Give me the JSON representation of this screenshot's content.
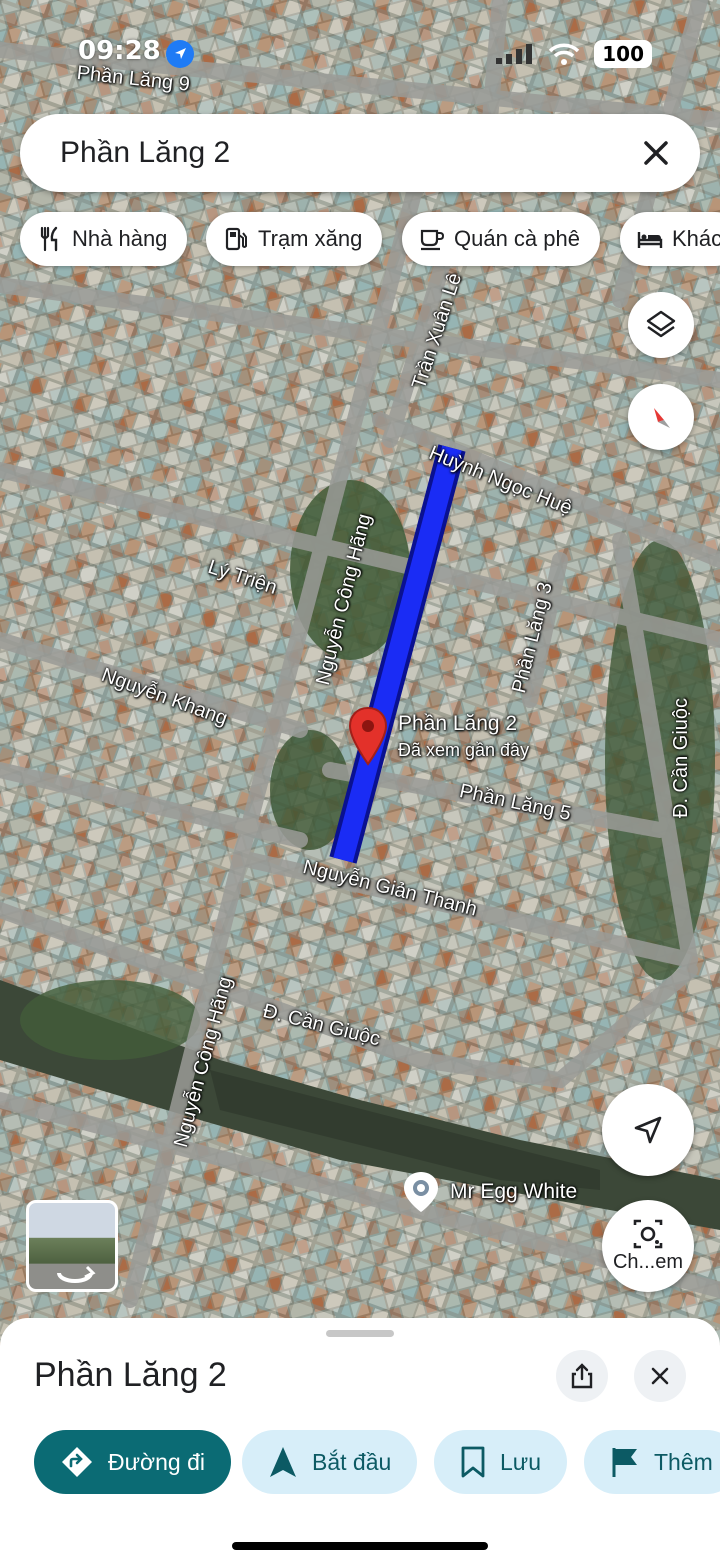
{
  "status_bar": {
    "time": "09:28",
    "battery": "100"
  },
  "search": {
    "query": "Phần Lăng 2"
  },
  "chips": [
    {
      "icon": "restaurant-icon",
      "label": "Nhà hàng"
    },
    {
      "icon": "gas-station-icon",
      "label": "Trạm xăng"
    },
    {
      "icon": "coffee-icon",
      "label": "Quán cà phê"
    },
    {
      "icon": "hotel-bed-icon",
      "label": "Khác"
    }
  ],
  "map": {
    "streets": [
      "Phần Lăng 9",
      "Trần Xuân Lê",
      "Huỳnh Ngọc Huệ",
      "Lý Triện",
      "Nguyễn Công Hãng",
      "Phần Lăng 3",
      "Nguyễn Khang",
      "Phần Lăng 5",
      "Nguyễn Giản Thanh",
      "Đ. Cần Giuộc",
      "Đ. Cần Giuộc",
      "Nguyễn Công Hãng"
    ],
    "pin": {
      "title": "Phần Lăng 2",
      "subtitle": "Đã xem gần đây"
    },
    "poi": {
      "name": "Mr Egg White"
    },
    "route_color": "#1a2cf5"
  },
  "map_controls": {
    "lens_label": "Ch...em"
  },
  "sheet": {
    "title": "Phần Lăng 2",
    "actions": [
      {
        "icon": "directions-icon",
        "label": "Đường đi"
      },
      {
        "icon": "navigation-arrow-icon",
        "label": "Bắt đầu"
      },
      {
        "icon": "bookmark-icon",
        "label": "Lưu"
      },
      {
        "icon": "flag-icon",
        "label": "Thêm"
      }
    ]
  }
}
